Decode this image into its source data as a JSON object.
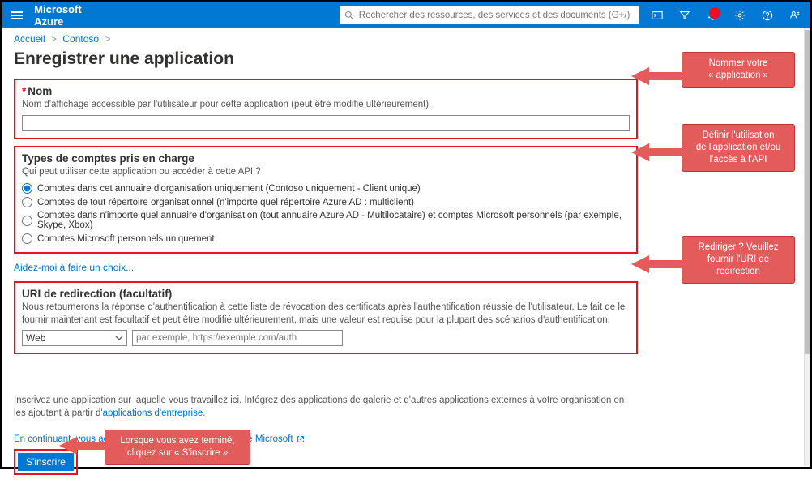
{
  "topbar": {
    "brand": "Microsoft Azure",
    "search_placeholder": "Rechercher des ressources, des services et des documents (G+/)"
  },
  "breadcrumb": {
    "home": "Accueil",
    "org": "Contoso"
  },
  "page": {
    "title": "Enregistrer une application"
  },
  "name_section": {
    "label": "Nom",
    "desc": "Nom d'affichage accessible par l'utilisateur pour cette application (peut être modifié ultérieurement)."
  },
  "accounts_section": {
    "label": "Types de comptes pris en charge",
    "question": "Qui peut utiliser cette application ou accéder à cette API ?",
    "options": [
      "Comptes dans cet annuaire d'organisation uniquement (Contoso uniquement - Client unique)",
      "Comptes de tout répertoire organisationnel (n'importe quel répertoire Azure AD : multiclient)",
      "Comptes dans n'importe quel annuaire d'organisation (tout annuaire Azure AD - Multilocataire) et comptes Microsoft personnels (par exemple, Skype, Xbox)",
      "Comptes Microsoft personnels uniquement"
    ],
    "help_link": "Aidez-moi à faire un choix..."
  },
  "redirect_section": {
    "label": "URI de redirection (facultatif)",
    "desc": "Nous retournerons la réponse d'authentification à cette liste de révocation des certificats après l'authentification réussie de l'utilisateur. Le fait de le fournir maintenant est facultatif et peut être modifié ultérieurement, mais une valeur est requise pour la plupart des scénarios d'authentification.",
    "select_value": "Web",
    "uri_placeholder": "par exemple, https://exemple.com/auth"
  },
  "footer": {
    "gallery_text_1": "Inscrivez une application sur laquelle vous travaillez ici. Intégrez des applications de galerie et d'autres applications externes à votre organisation en les ajoutant à partir d'",
    "gallery_link": "applications d'entreprise",
    "policy_text": "En continuant, vous acceptez les stratégies de plateforme Microsoft",
    "register_label": "S'inscrire"
  },
  "callouts": {
    "c1_l1": "Nommer votre",
    "c1_l2": "« application »",
    "c2_l1": "Définir l'utilisation",
    "c2_l2": "de l'application et/ou",
    "c2_l3": "l'accès à l'API",
    "c3_l1": "Rediriger ? Veuillez",
    "c3_l2": "fournir l'URI de",
    "c3_l3": "redirection",
    "c4_l1": "Lorsque vous avez terminé,",
    "c4_l2": "cliquez sur « S'inscrire »"
  }
}
